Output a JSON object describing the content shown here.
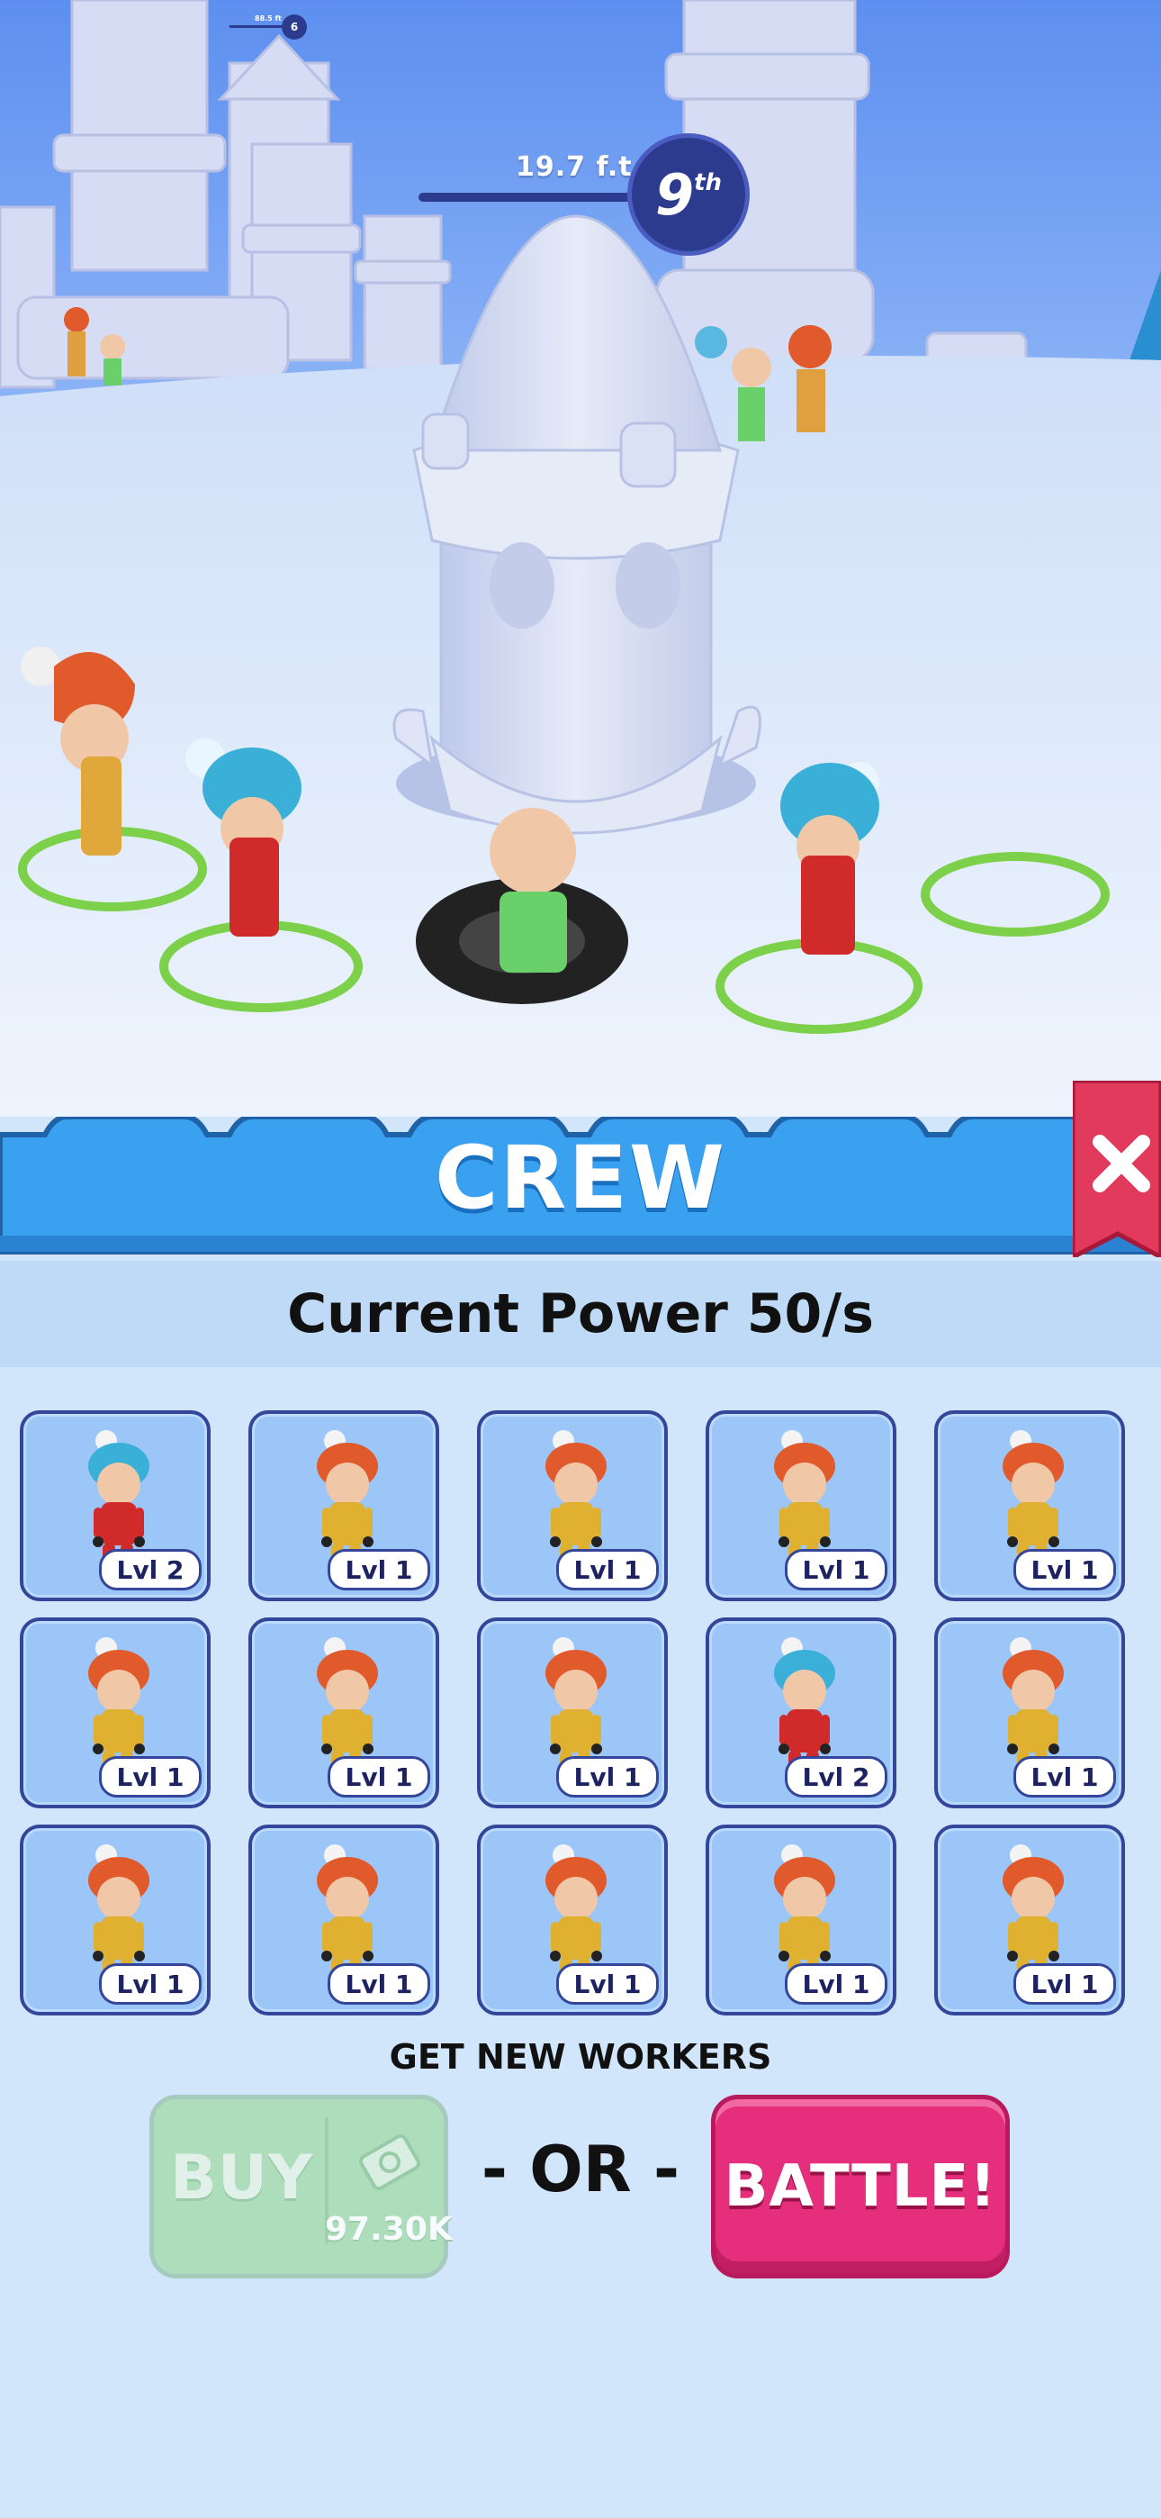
{
  "hud": {
    "distance": "19.7 f.t",
    "rank": "9",
    "rank_suffix": "th",
    "mini_distance": "88.5 ft",
    "mini_rank": "6"
  },
  "panel": {
    "title": "CREW",
    "close_label": "✕",
    "power_text": "Current Power 50/s"
  },
  "workers": [
    {
      "level": "Lvl 2",
      "hat": "blue"
    },
    {
      "level": "Lvl 1",
      "hat": "orange"
    },
    {
      "level": "Lvl 1",
      "hat": "orange"
    },
    {
      "level": "Lvl 1",
      "hat": "orange"
    },
    {
      "level": "Lvl 1",
      "hat": "orange"
    },
    {
      "level": "Lvl 1",
      "hat": "orange"
    },
    {
      "level": "Lvl 1",
      "hat": "orange"
    },
    {
      "level": "Lvl 1",
      "hat": "orange"
    },
    {
      "level": "Lvl 2",
      "hat": "blue"
    },
    {
      "level": "Lvl 1",
      "hat": "orange"
    },
    {
      "level": "Lvl 1",
      "hat": "orange"
    },
    {
      "level": "Lvl 1",
      "hat": "orange"
    },
    {
      "level": "Lvl 1",
      "hat": "orange"
    },
    {
      "level": "Lvl 1",
      "hat": "orange"
    },
    {
      "level": "Lvl 1",
      "hat": "orange"
    }
  ],
  "actions": {
    "get_new_label": "GET NEW WORKERS",
    "buy_label": "BUY",
    "buy_price": "97.30K",
    "or_label": "- OR -",
    "battle_label": "BATTLE!"
  },
  "colors": {
    "panel_blue": "#3aa0f0",
    "battle_pink": "#e62f7c",
    "buy_green_disabled": "#a8dcb0",
    "card_blue": "#9cc6f7",
    "card_border": "#34469a"
  }
}
